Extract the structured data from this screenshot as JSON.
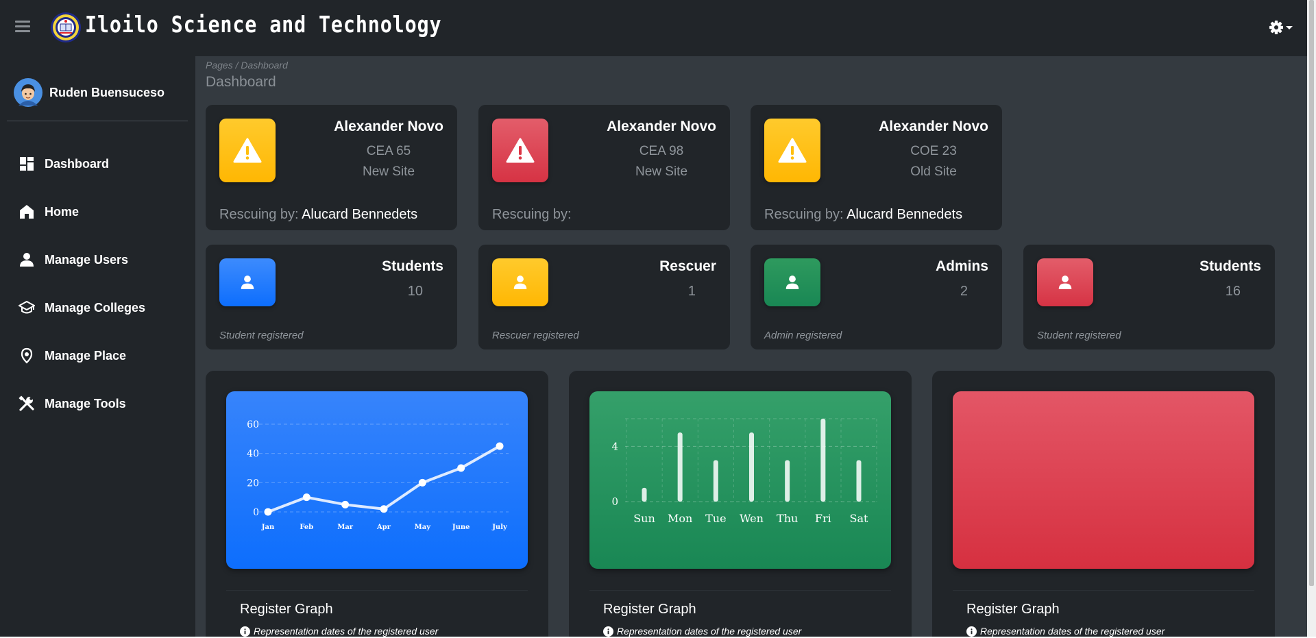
{
  "app": {
    "title": "Iloilo Science and Technology",
    "icons": {
      "menu": "hamburger-icon",
      "logo": "university-seal",
      "settings": "gear-icon"
    }
  },
  "sidebar": {
    "user_name": "Ruden Buensuceso",
    "items": [
      {
        "label": "Dashboard",
        "icon": "dashboard-icon"
      },
      {
        "label": "Home",
        "icon": "home-icon"
      },
      {
        "label": "Manage Users",
        "icon": "user-icon"
      },
      {
        "label": "Manage Colleges",
        "icon": "graduation-cap-icon"
      },
      {
        "label": "Manage Place",
        "icon": "map-pin-icon"
      },
      {
        "label": "Manage Tools",
        "icon": "tools-icon"
      }
    ]
  },
  "header": {
    "breadcrumb": "Pages / Dashboard",
    "title": "Dashboard"
  },
  "alerts": [
    {
      "name": "Alexander Novo",
      "location": "CEA 65",
      "site": "New Site",
      "rescuing_label": "Rescuing by:",
      "rescuer": "Alucard Bennedets",
      "color": "#ffc107"
    },
    {
      "name": "Alexander Novo",
      "location": "CEA 98",
      "site": "New Site",
      "rescuing_label": "Rescuing by:",
      "rescuer": "",
      "color": "#dc3545"
    },
    {
      "name": "Alexander Novo",
      "location": "COE 23",
      "site": "Old Site",
      "rescuing_label": "Rescuing by:",
      "rescuer": "Alucard Bennedets",
      "color": "#ffc107"
    }
  ],
  "counts": [
    {
      "title": "Students",
      "value": "10",
      "footer": "Student registered",
      "color": "#0d6efd"
    },
    {
      "title": "Rescuer",
      "value": "1",
      "footer": "Rescuer registered",
      "color": "#ffc107"
    },
    {
      "title": "Admins",
      "value": "2",
      "footer": "Admin registered",
      "color": "#198754"
    },
    {
      "title": "Students",
      "value": "16",
      "footer": "Student registered",
      "color": "#dc3545"
    }
  ],
  "graph_cards": [
    {
      "title": "Register Graph",
      "subtitle": "Representation dates of the registered user"
    },
    {
      "title": "Register Graph",
      "subtitle": "Representation dates of the registered user"
    },
    {
      "title": "Register Graph",
      "subtitle": "Representation dates of the registered user"
    }
  ],
  "chart_data": [
    {
      "type": "line",
      "categories": [
        "Jan",
        "Feb",
        "Mar",
        "Apr",
        "May",
        "June",
        "July"
      ],
      "values": [
        0,
        10,
        5,
        2,
        20,
        30,
        45
      ],
      "yticks": [
        0,
        20,
        40,
        60
      ],
      "ylim": [
        0,
        60
      ],
      "grid": true,
      "color": "#0d6efd"
    },
    {
      "type": "bar",
      "categories": [
        "Sun",
        "Mon",
        "Tue",
        "Wen",
        "Thu",
        "Fri",
        "Sat"
      ],
      "values": [
        1,
        5,
        3,
        5,
        3,
        6,
        3
      ],
      "yticks": [
        0,
        4
      ],
      "ylim": [
        0,
        6
      ],
      "grid": true,
      "color": "#198754"
    },
    {
      "type": "line",
      "categories": [],
      "values": [],
      "color": "#dc3545"
    }
  ]
}
